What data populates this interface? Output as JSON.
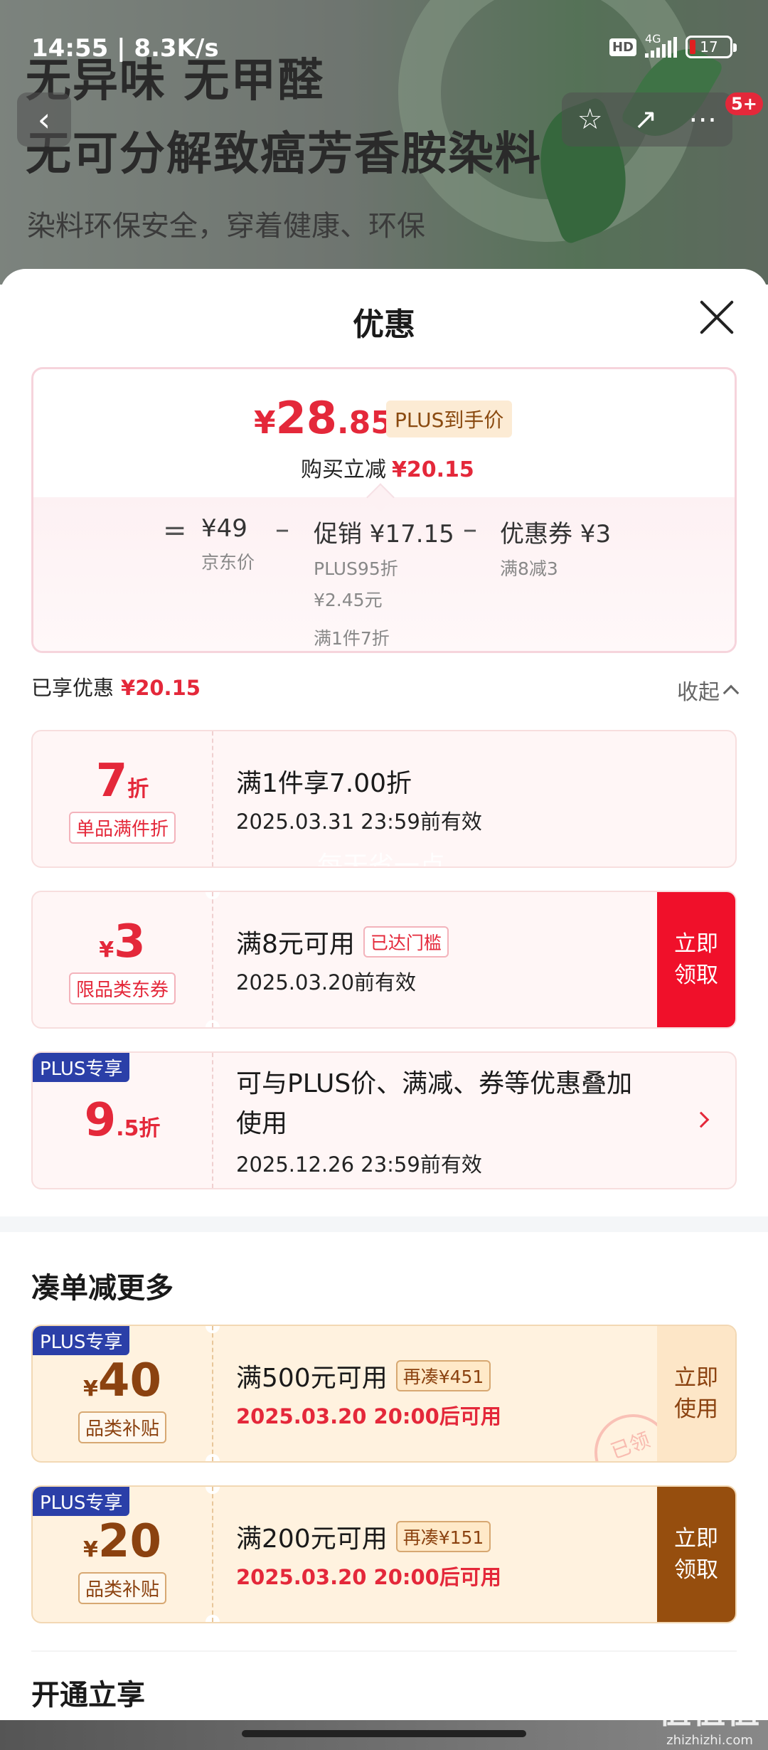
{
  "status_bar": {
    "time": "14:55 | 8.3K/s",
    "hd": "HD",
    "network": "4G",
    "battery": "17"
  },
  "banner": {
    "line1": "无异味 无甲醛",
    "line2": "无可分解致癌芳香胺染料",
    "line3": "染料环保安全，穿着健康、环保",
    "cart_count": "5+"
  },
  "sheet": {
    "title": "优惠",
    "price": {
      "currency": "¥",
      "integer": "28",
      "decimal": ".85",
      "plus_tag": "PLUS到手价",
      "instant_label": "购买立减",
      "instant_value": "¥20.15"
    },
    "breakdown": {
      "equals": "=",
      "minus": "–",
      "jd_price": "¥49",
      "jd_label": "京东价",
      "promo_main": "促销 ¥17.15",
      "promo_sub1": "PLUS95折",
      "promo_sub2": "¥2.45元",
      "promo_sub3": "满1件7折",
      "coupon_main": "优惠券 ¥3",
      "coupon_sub": "满8减3"
    },
    "enjoyed_label": "已享优惠",
    "enjoyed_value": "¥20.15",
    "collapse_label": "收起",
    "coupons": [
      {
        "num": "7",
        "unit": "折",
        "tag": "单品满件折",
        "title": "满1件享7.00折",
        "valid": "2025.03.31 23:59前有效",
        "overlay": "每天省一点"
      },
      {
        "prefix": "¥",
        "num": "3",
        "tag": "限品类东券",
        "title": "满8元可用",
        "badge": "已达门槛",
        "valid": "2025.03.20前有效",
        "action": "立即领取"
      },
      {
        "plus": "PLUS专享",
        "num": "9",
        "unit": ".5折",
        "title_line1": "可与PLUS价、满减、券等优惠叠加",
        "title_line2": "使用",
        "valid": "2025.12.26 23:59前有效"
      }
    ],
    "more_title": "凑单减更多",
    "more_coupons": [
      {
        "plus": "PLUS专享",
        "prefix": "¥",
        "num": "40",
        "tag": "品类补贴",
        "title": "满500元可用",
        "badge": "再凑¥451",
        "valid": "2025.03.20 20:00后可用",
        "action": "立即使用",
        "stamp": "已领"
      },
      {
        "plus": "PLUS专享",
        "prefix": "¥",
        "num": "20",
        "tag": "品类补贴",
        "title": "满200元可用",
        "badge": "再凑¥151",
        "valid": "2025.03.20 20:00后可用",
        "action": "立即领取"
      }
    ],
    "open_title": "开通立享"
  },
  "watermark": {
    "logo": "值值值",
    "url": "zhizhizhi.com"
  }
}
